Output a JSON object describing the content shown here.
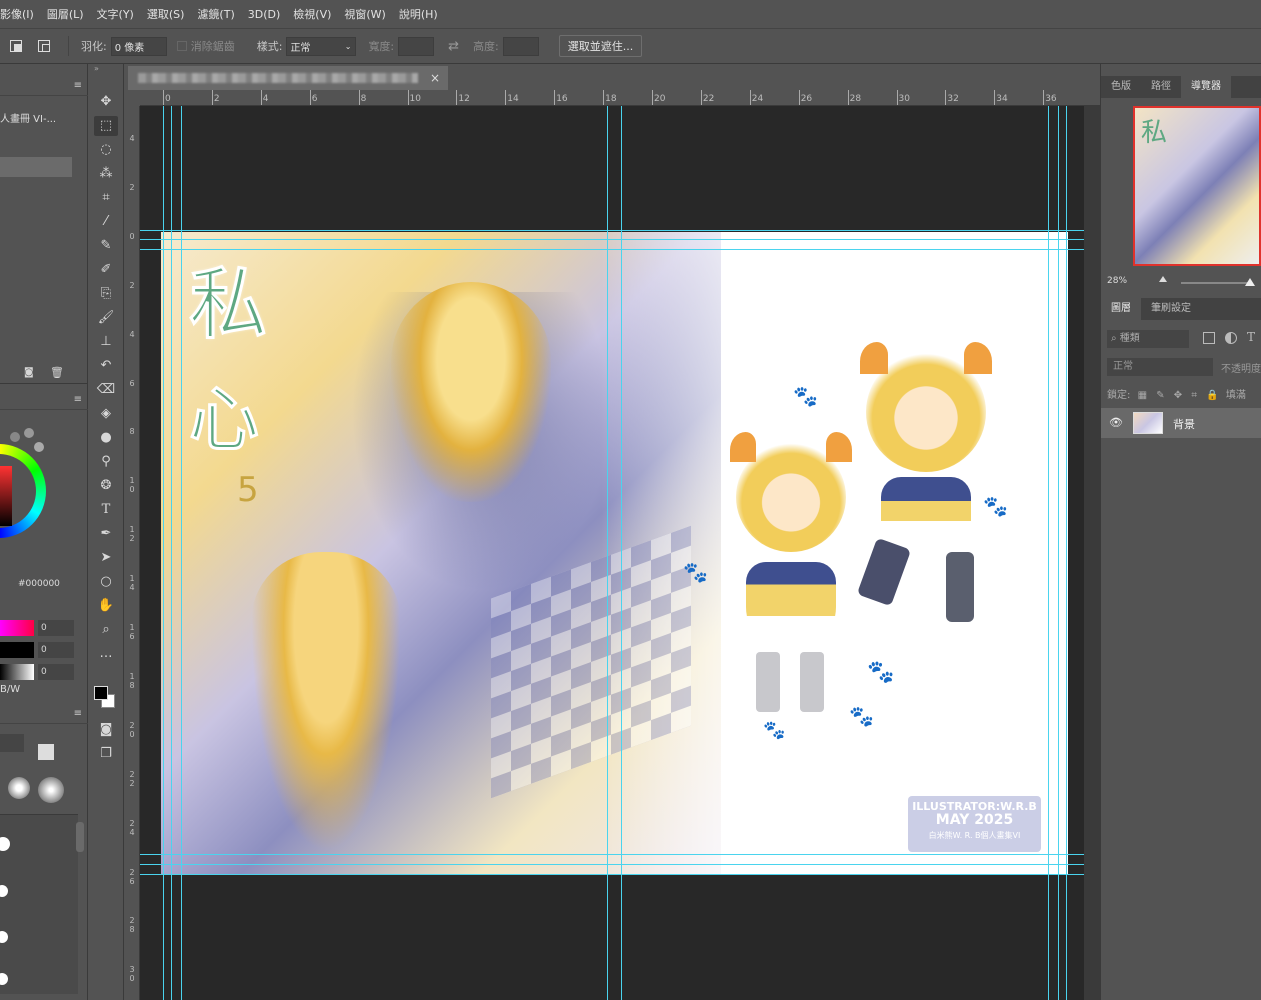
{
  "menu": [
    "影像(I)",
    "圖層(L)",
    "文字(Y)",
    "選取(S)",
    "濾鏡(T)",
    "3D(D)",
    "檢視(V)",
    "視窗(W)",
    "說明(H)"
  ],
  "options": {
    "feather_label": "羽化:",
    "feather_value": "0 像素",
    "antialias_label": "消除鋸齒",
    "style_label": "樣式:",
    "style_value": "正常",
    "width_label": "寬度:",
    "height_label": "高度:",
    "select_mask_button": "選取並遮住..."
  },
  "left_panel": {
    "history_item": "人畫冊 VI-...",
    "color_hex": "000000",
    "sliders": [
      "0",
      "0",
      "0"
    ],
    "mode_label": "B/W"
  },
  "document": {
    "tab_close": "×"
  },
  "rulers": {
    "h_ticks": [
      "0",
      "2",
      "4",
      "6",
      "8",
      "10",
      "12",
      "14",
      "16",
      "18",
      "20",
      "22",
      "24",
      "26",
      "28",
      "30",
      "32",
      "34",
      "36"
    ],
    "v_ticks": [
      "4",
      "2",
      "0",
      "2",
      "4",
      "6",
      "8",
      "1\n0",
      "1\n2",
      "1\n4",
      "1\n6",
      "1\n8",
      "2\n0",
      "2\n2",
      "2\n4",
      "2\n6",
      "2\n8",
      "3\n0"
    ]
  },
  "artwork": {
    "title_chars": [
      "私",
      "心",
      "5"
    ],
    "credit_line1": "ILLUSTRATOR:W.R.B",
    "credit_line2": "MAY 2025",
    "credit_line3": "白米熊W. R. B個人畫集VI"
  },
  "right_panel": {
    "top_tabs": [
      "色版",
      "路徑",
      "導覽器"
    ],
    "zoom": "28%",
    "layer_tabs": [
      "圖層",
      "筆刷設定"
    ],
    "filter_label": "種類",
    "blend_mode": "正常",
    "opacity_label": "不透明度",
    "lock_label": "鎖定:",
    "fill_label": "填滿",
    "layer_name": "背景"
  },
  "colors": {
    "guide": "#4ad4ee",
    "canvas_dark": "#282828",
    "panel": "#535353"
  }
}
